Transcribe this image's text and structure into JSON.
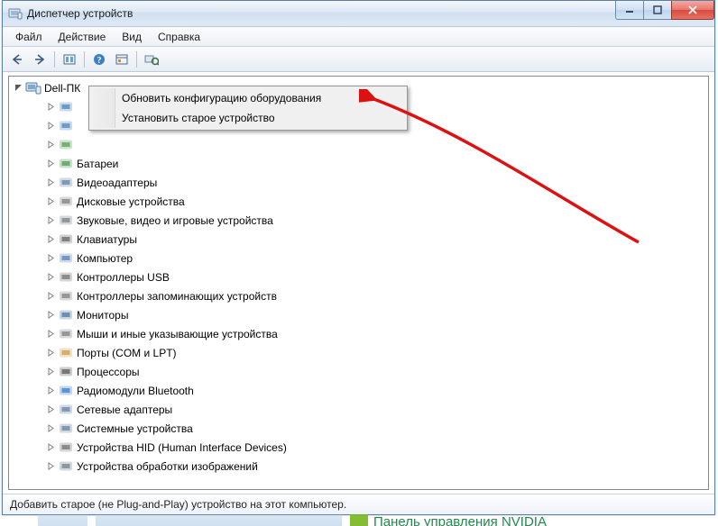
{
  "window": {
    "title": "Диспетчер устройств"
  },
  "menubar": {
    "items": [
      "Файл",
      "Действие",
      "Вид",
      "Справка"
    ]
  },
  "toolbar": {
    "icons": [
      "nav-back-icon",
      "nav-forward-icon",
      "show-hidden-icon",
      "help-icon",
      "properties-icon",
      "scan-hardware-icon"
    ]
  },
  "tree": {
    "root": {
      "label": "Dell-ПК",
      "expanded": true
    },
    "children": [
      {
        "iconColor": "#2f6fb0",
        "label": ""
      },
      {
        "iconColor": "#2f6fb0",
        "label": ""
      },
      {
        "iconColor": "#3a8f3a",
        "label": ""
      },
      {
        "iconColor": "#2d8b3a",
        "label": "Батареи"
      },
      {
        "iconColor": "#4a6f93",
        "label": "Видеоадаптеры"
      },
      {
        "iconColor": "#6b6b6b",
        "label": "Дисковые устройства"
      },
      {
        "iconColor": "#5f6b76",
        "label": "Звуковые, видео и игровые устройства"
      },
      {
        "iconColor": "#4b4b4b",
        "label": "Клавиатуры"
      },
      {
        "iconColor": "#3b6ea5",
        "label": "Компьютер"
      },
      {
        "iconColor": "#5b5b5b",
        "label": "Контроллеры USB"
      },
      {
        "iconColor": "#6a6a6a",
        "label": "Контроллеры запоминающих устройств"
      },
      {
        "iconColor": "#2e5e8f",
        "label": "Мониторы"
      },
      {
        "iconColor": "#6b6b6b",
        "label": "Мыши и иные указывающие устройства"
      },
      {
        "iconColor": "#c58a2a",
        "label": "Порты (COM и LPT)"
      },
      {
        "iconColor": "#3d3d3d",
        "label": "Процессоры"
      },
      {
        "iconColor": "#1567c7",
        "label": "Радиомодули Bluetooth"
      },
      {
        "iconColor": "#4a6f93",
        "label": "Сетевые адаптеры"
      },
      {
        "iconColor": "#4e6c8a",
        "label": "Системные устройства"
      },
      {
        "iconColor": "#5c5c5c",
        "label": "Устройства HID (Human Interface Devices)"
      },
      {
        "iconColor": "#5c6c7c",
        "label": "Устройства обработки изображений"
      }
    ]
  },
  "context_menu": {
    "items": [
      "Обновить конфигурацию оборудования",
      "Установить старое устройство"
    ]
  },
  "statusbar": {
    "text": "Добавить старое (не Plug-and-Play) устройство на этот компьютер."
  },
  "below_window": {
    "nvidia_link": "Панель управления NVIDIA"
  }
}
